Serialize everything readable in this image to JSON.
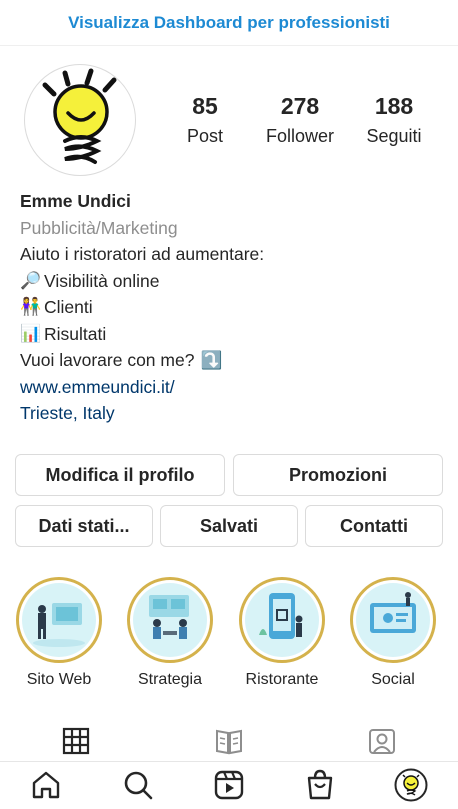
{
  "header": {
    "dashboard_link": "Visualizza Dashboard per professionisti"
  },
  "stats": [
    {
      "value": "85",
      "label": "Post"
    },
    {
      "value": "278",
      "label": "Follower"
    },
    {
      "value": "188",
      "label": "Seguiti"
    }
  ],
  "bio": {
    "name": "Emme Undici",
    "category": "Pubblicità/Marketing",
    "intro": "Aiuto i ristoratori ad aumentare:",
    "items": [
      {
        "emoji": "🔎",
        "text": "Visibilità online"
      },
      {
        "emoji": "👫",
        "text": "Clienti"
      },
      {
        "emoji": "📊",
        "text": "Risultati"
      }
    ],
    "cta": "Vuoi lavorare con me?",
    "cta_emoji": "⤵️",
    "website": "www.emmeundici.it/",
    "location": "Trieste, Italy"
  },
  "buttons": {
    "edit_profile": "Modifica il profilo",
    "promotions": "Promozioni",
    "insights": "Dati stati...",
    "saved": "Salvati",
    "contacts": "Contatti"
  },
  "highlights": [
    {
      "label": "Sito Web"
    },
    {
      "label": "Strategia"
    },
    {
      "label": "Ristorante"
    },
    {
      "label": "Social"
    }
  ],
  "tabs": [
    "grid-icon",
    "guide-icon",
    "tagged-icon"
  ],
  "nav": [
    "home-icon",
    "search-icon",
    "reels-icon",
    "shop-icon",
    "profile-avatar"
  ],
  "colors": {
    "link": "#1d8ad3",
    "bio_link": "#00376b",
    "highlight_ring": "#d4b24c",
    "bulb": "#f5f03a"
  }
}
